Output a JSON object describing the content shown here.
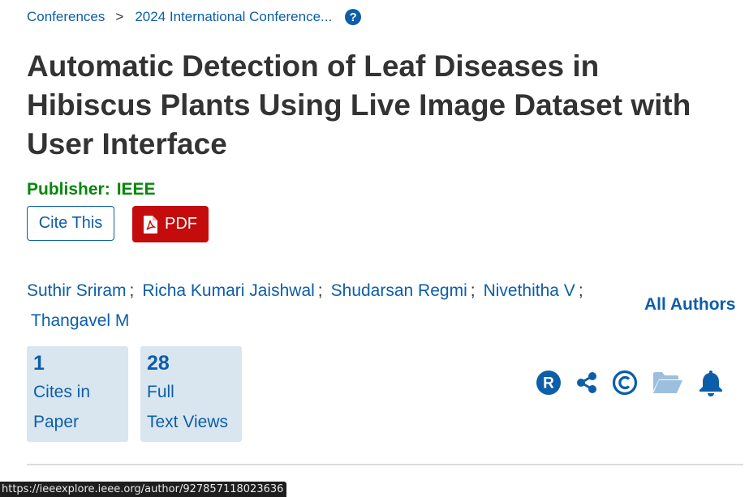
{
  "breadcrumb": {
    "items": [
      "Conferences",
      "2024 International Conference..."
    ],
    "separator": ">",
    "help_icon": "question-circle-icon"
  },
  "title": "Automatic Detection of Leaf Diseases in Hibiscus Plants Using Live Image Dataset with User Interface",
  "publisher": {
    "label": "Publisher:",
    "value": "IEEE",
    "color": "#06870a"
  },
  "buttons": {
    "cite": "Cite This",
    "pdf": "PDF",
    "pdf_icon": "pdf-file-icon",
    "pdf_color": "#c40c0c"
  },
  "authors": {
    "list": [
      "Suthir Sriram",
      "Richa Kumari Jaishwal",
      "Shudarsan Regmi",
      "Nivethitha V",
      "Thangavel M"
    ],
    "separator": ";",
    "all_label": "All Authors"
  },
  "metrics": [
    {
      "value": "1",
      "label": "Cites in\nPaper"
    },
    {
      "value": "28",
      "label": "Full\nText Views"
    }
  ],
  "actions": {
    "icons": [
      "rights-r-icon",
      "share-icon",
      "copyright-icon",
      "folder-icon",
      "bell-icon"
    ]
  },
  "status_bar": {
    "url": "https://ieeexplore.ieee.org/author/927857118023636"
  },
  "colors": {
    "link": "#0c5ea8",
    "text": "#333333",
    "metric_bg": "#d9e6ef"
  }
}
